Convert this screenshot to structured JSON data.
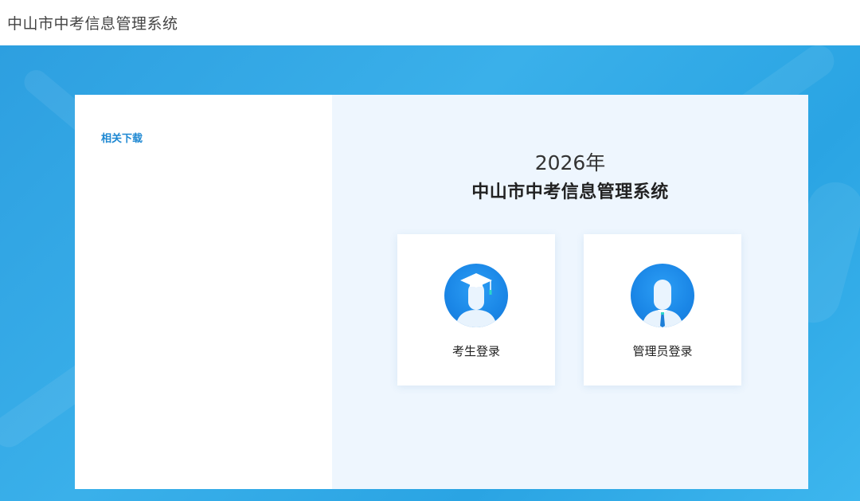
{
  "header": {
    "title": "中山市中考信息管理系统"
  },
  "sidebar": {
    "section_title": "相关下载"
  },
  "main": {
    "year": "2026年",
    "system_name": "中山市中考信息管理系统",
    "login_options": [
      {
        "label": "考生登录",
        "icon": "student-avatar-icon"
      },
      {
        "label": "管理员登录",
        "icon": "admin-avatar-icon"
      }
    ]
  },
  "colors": {
    "background": "#2fa8e6",
    "accent": "#1e88d2",
    "avatar": "#1a86e6",
    "right_panel": "#eef6fe"
  }
}
